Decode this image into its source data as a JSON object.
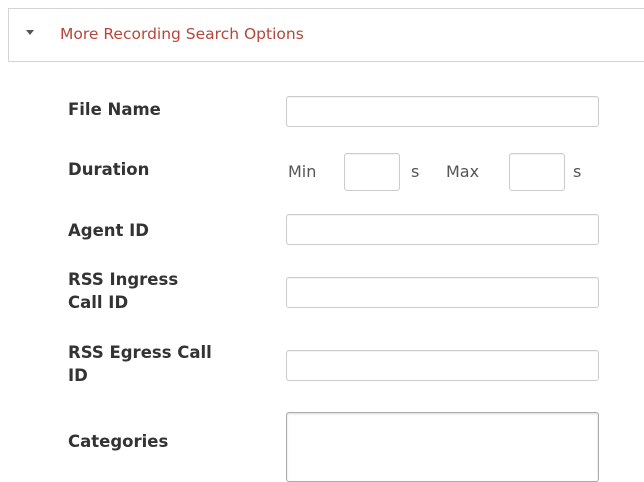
{
  "panel": {
    "title": "More Recording Search Options"
  },
  "fields": {
    "file_name": {
      "label": "File Name",
      "value": ""
    },
    "duration": {
      "label": "Duration",
      "min_label": "Min",
      "min_value": "",
      "min_unit": "s",
      "max_label": "Max",
      "max_value": "",
      "max_unit": "s"
    },
    "agent_id": {
      "label": "Agent ID",
      "value": ""
    },
    "rss_ingress_call_id": {
      "label": "RSS Ingress\nCall ID",
      "value": ""
    },
    "rss_egress_call_id": {
      "label": "RSS Egress Call\nID",
      "value": ""
    },
    "categories": {
      "label": "Categories",
      "value": ""
    }
  },
  "icons": {
    "panel_toggle": "caret-down-icon"
  },
  "colors": {
    "panel_title": "#b5473a",
    "label": "#333333",
    "input_border": "#cccccc"
  }
}
